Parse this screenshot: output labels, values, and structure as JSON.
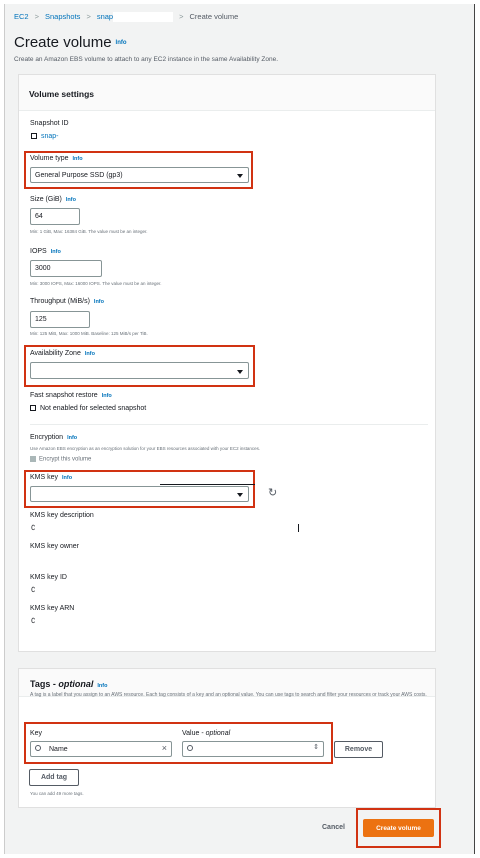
{
  "breadcrumb": {
    "items": [
      "EC2",
      "Snapshots",
      "snap"
    ],
    "current": "Create volume"
  },
  "header": {
    "title": "Create volume",
    "info": "Info",
    "description": "Create an Amazon EBS volume to attach to any EC2 instance in the same Availability Zone."
  },
  "settings": {
    "title": "Volume settings",
    "snapshot_id_label": "Snapshot ID",
    "snapshot_id_value": "snap-",
    "volume_type_label": "Volume type",
    "volume_type_value": "General Purpose SSD (gp3)",
    "size_label": "Size (GiB)",
    "size_value": "64",
    "size_hint": "Min: 1 GiB, Max: 16384 GiB. The value must be an integer.",
    "iops_label": "IOPS",
    "iops_value": "3000",
    "iops_hint": "Min: 3000 IOPS, Max: 16000 IOPS. The value must be an integer.",
    "throughput_label": "Throughput (MiB/s)",
    "throughput_value": "125",
    "throughput_hint": "Min: 125 MiB, Max: 1000 MiB. Baseline: 125 MiB/s per TiB.",
    "az_label": "Availability Zone",
    "az_value": "",
    "fsr_label": "Fast snapshot restore",
    "fsr_value": "Not enabled for selected snapshot",
    "encryption_label": "Encryption",
    "encryption_hint": "Use Amazon EBS encryption as an encryption solution for your EBS resources associated with your EC2 instances.",
    "encrypt_checkbox": "Encrypt this volume",
    "kms_key_label": "KMS key",
    "kms_desc_label": "KMS key description",
    "kms_owner_label": "KMS key owner",
    "kms_id_label": "KMS key ID",
    "kms_arn_label": "KMS key ARN",
    "info": "Info"
  },
  "tags": {
    "title": "Tags -",
    "title_optional": "optional",
    "info": "Info",
    "description": "A tag is a label that you assign to an AWS resource. Each tag consists of a key and an optional value. You can use tags to search and filter your resources or track your AWS costs.",
    "key_label": "Key",
    "value_label": "Value -",
    "value_optional": "optional",
    "key_value": "Name",
    "value_value": "",
    "remove_button": "Remove",
    "add_button": "Add tag",
    "remaining_hint": "You can add 49 more tags."
  },
  "footer": {
    "cancel": "Cancel",
    "create": "Create volume"
  },
  "colors": {
    "accent": "#ec7211",
    "highlight": "#d13212",
    "link": "#0073bb"
  }
}
